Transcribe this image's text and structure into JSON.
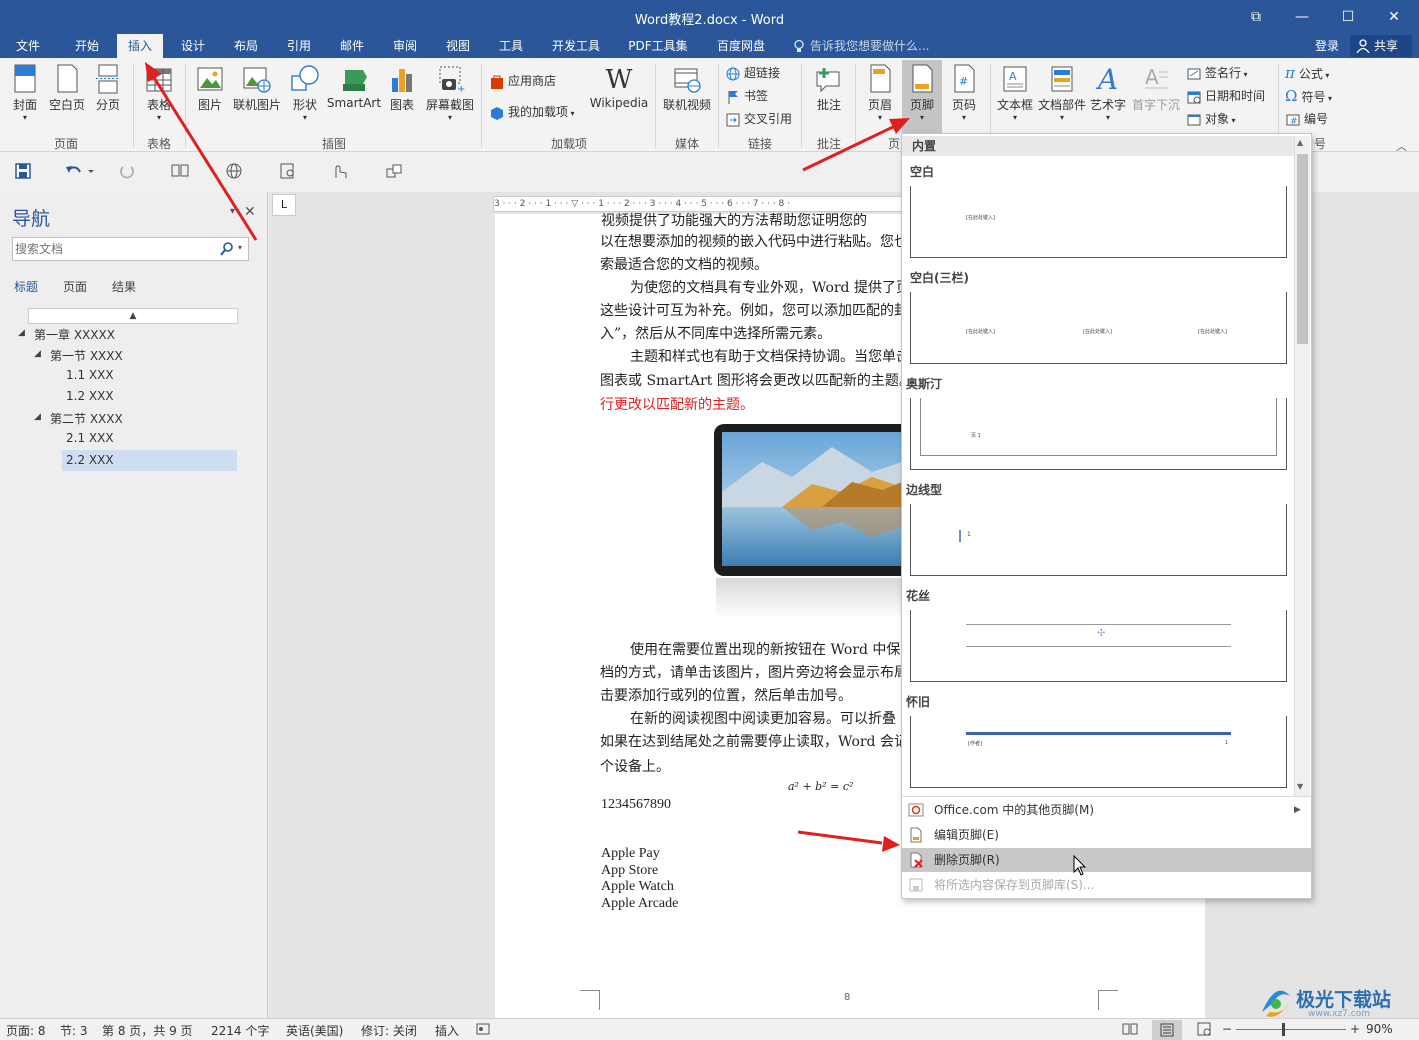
{
  "window": {
    "title": "Word教程2.docx - Word",
    "controls": [
      "⧉",
      "—",
      "☐",
      "✕"
    ]
  },
  "menu": {
    "tabs": [
      "文件",
      "开始",
      "插入",
      "设计",
      "布局",
      "引用",
      "邮件",
      "审阅",
      "视图",
      "工具",
      "开发工具",
      "PDF工具集",
      "百度网盘"
    ],
    "active": "插入",
    "tell_me": "告诉我您想要做什么...",
    "login": "登录",
    "share": "共享"
  },
  "ribbon": {
    "pages": {
      "cover": "封面",
      "blank": "空白页",
      "break": "分页",
      "group": "页面"
    },
    "table": {
      "table": "表格",
      "group": "表格"
    },
    "illustrations": {
      "picture": "图片",
      "online_picture": "联机图片",
      "shapes": "形状",
      "smartart": "SmartArt",
      "chart": "图表",
      "screenshot": "屏幕截图",
      "group": "插图"
    },
    "addins": {
      "store": "应用商店",
      "my_addins": "我的加载项",
      "wikipedia": "Wikipedia",
      "group": "加载项"
    },
    "media": {
      "online_video": "联机视频",
      "group": "媒体"
    },
    "links": {
      "hyperlink": "超链接",
      "bookmark": "书签",
      "crossref": "交叉引用",
      "group": "链接"
    },
    "comments": {
      "comment": "批注",
      "group": "批注"
    },
    "header_footer": {
      "header": "页眉",
      "footer": "页脚",
      "page_number": "页码",
      "group": "页"
    },
    "text": {
      "textbox": "文本框",
      "quickparts": "文档部件",
      "wordart": "艺术字",
      "dropcap": "首字下沉",
      "signature": "签名行",
      "datetime": "日期和时间",
      "object": "对象"
    },
    "symbols": {
      "equation": "公式",
      "symbol": "符号",
      "number": "编号",
      "group": "号"
    }
  },
  "nav": {
    "title": "导航",
    "search_placeholder": "搜索文档",
    "tabs": [
      "标题",
      "页面",
      "结果"
    ],
    "tree": [
      {
        "label": "第一章 XXXXX"
      },
      {
        "label": "第一节 XXXX"
      },
      {
        "label": "1.1 XXX"
      },
      {
        "label": "1.2 XXX"
      },
      {
        "label": "第二节 XXXX"
      },
      {
        "label": "2.1 XXX"
      },
      {
        "label": "2.2 XXX"
      }
    ],
    "selected": "2.2 XXX"
  },
  "ruler": {
    "text": "3 · · · 2 · · · 1 · · · ▽ · · · 1 · · · 2 · · · 3 · · · 4 · · · 5 · · · 6 · · · 7 · · · 8 ·"
  },
  "tab_stop_button": "L",
  "document": {
    "lines": [
      "视频提供了功能强大的方法帮助您证明您的",
      "以在想要添加的视频的嵌入代码中进行粘贴。您也",
      "索最适合您的文档的视频。",
      "为使您的文档具有专业外观，Word 提供了页",
      "这些设计可互为补充。例如，您可以添加匹配的封",
      "入”，然后从不同库中选择所需元素。",
      "主题和样式也有助于文档保持协调。当您单击",
      "图表或 SmartArt 图形将会更改以匹配新的主题。",
      "行更改以匹配新的主题。",
      "使用在需要位置出现的新按钮在 Word 中保",
      "档的方式，请单击该图片，图片旁边将会显示布局",
      "击要添加行或列的位置，然后单击加号。",
      "在新的阅读视图中阅读更加容易。可以折叠",
      "如果在达到结尾处之前需要停止读取，Word 会记",
      "个设备上。"
    ],
    "equation": "a² + b² = c²",
    "number_line": "1234567890",
    "list": [
      "Apple Pay",
      "App Store",
      "Apple Watch",
      "Apple Arcade"
    ],
    "page_number": "8",
    "red_color": "#e02020"
  },
  "dropdown": {
    "section": "内置",
    "galleries": [
      {
        "name": "空白",
        "placeholders": [
          "[在此处键入]"
        ]
      },
      {
        "name": "空白(三栏)",
        "placeholders": [
          "[在此处键入]",
          "[在此处键入]",
          "[在此处键入]"
        ]
      },
      {
        "name": "奥斯汀",
        "placeholders": [
          "页 1"
        ]
      },
      {
        "name": "边线型",
        "placeholders": [
          "1"
        ]
      },
      {
        "name": "花丝",
        "placeholders": []
      },
      {
        "name": "怀旧",
        "placeholders": [
          "[作者]",
          "1"
        ]
      }
    ],
    "menu": [
      {
        "label": "Office.com 中的其他页脚(M)",
        "has_submenu": true
      },
      {
        "label": "编辑页脚(E)"
      },
      {
        "label": "删除页脚(R)",
        "highlighted": true
      },
      {
        "label": "将所选内容保存到页脚库(S)...",
        "disabled": true
      }
    ]
  },
  "status": {
    "page": "页面: 8",
    "section": "节: 3",
    "pages": "第 8 页，共 9 页",
    "words": "2214 个字",
    "language": "英语(美国)",
    "track": "修订: 关闭",
    "mode": "插入",
    "zoom": "90%"
  },
  "watermark": {
    "text": "极光下载站",
    "url": "www.xz7.com"
  },
  "colors": {
    "accent": "#2b579a",
    "arrow": "#e02020"
  }
}
